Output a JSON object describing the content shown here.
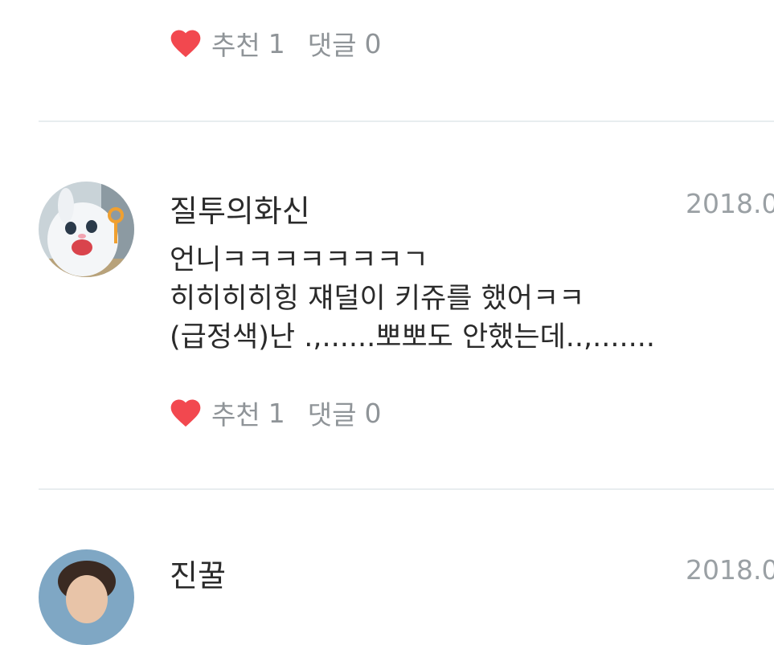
{
  "comments": [
    {
      "likes_label": "추천",
      "likes_count": "1",
      "replies_label": "댓글",
      "replies_count": "0"
    },
    {
      "author": "질투의화신",
      "date": "2018.0",
      "lines": [
        "언니ㅋㅋㅋㅋㅋㅋㅋㄱ",
        "히히히히힝 쟤덜이 키쥬를 했어ㅋㅋ",
        "(급정색)난 .,......뽀뽀도 안했는데..,......."
      ],
      "likes_label": "추천",
      "likes_count": "1",
      "replies_label": "댓글",
      "replies_count": "0"
    },
    {
      "author": "진꿀",
      "date": "2018.0"
    }
  ],
  "colors": {
    "heart": "#f2484f",
    "divider": "#e8edef",
    "meta_text": "#8f9498"
  },
  "icons": [
    "heart-icon"
  ]
}
